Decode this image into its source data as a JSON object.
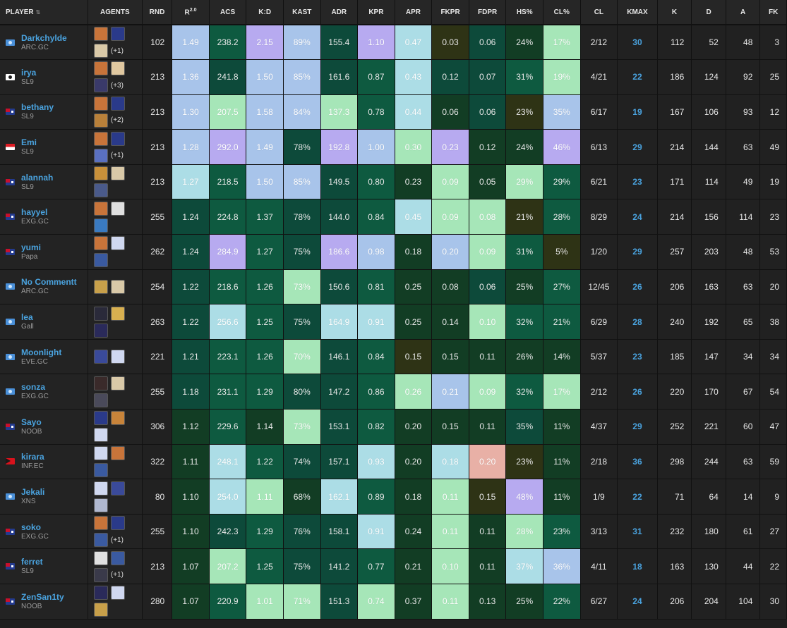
{
  "columns": [
    {
      "key": "player",
      "label": "PLAYER",
      "sort": true
    },
    {
      "key": "agents",
      "label": "AGENTS",
      "sort": false
    },
    {
      "key": "rnd",
      "label": "RND",
      "sort": true
    },
    {
      "key": "r2",
      "label": "R",
      "sup": "2.0",
      "sort": true
    },
    {
      "key": "acs",
      "label": "ACS",
      "sort": true
    },
    {
      "key": "kd",
      "label": "K:D",
      "sort": true
    },
    {
      "key": "kast",
      "label": "KAST",
      "sort": true
    },
    {
      "key": "adr",
      "label": "ADR",
      "sort": true
    },
    {
      "key": "kpr",
      "label": "KPR",
      "sort": true
    },
    {
      "key": "apr",
      "label": "APR",
      "sort": true
    },
    {
      "key": "fkpr",
      "label": "FKPR",
      "sort": true
    },
    {
      "key": "fdpr",
      "label": "FDPR",
      "sort": true
    },
    {
      "key": "hs",
      "label": "HS%",
      "sort": true
    },
    {
      "key": "clp",
      "label": "CL%",
      "sort": true
    },
    {
      "key": "cl",
      "label": "CL",
      "sort": true
    },
    {
      "key": "kmax",
      "label": "KMAX",
      "sort": true
    },
    {
      "key": "k",
      "label": "K",
      "sort": true
    },
    {
      "key": "d",
      "label": "D",
      "sort": true
    },
    {
      "key": "a",
      "label": "A",
      "sort": true
    },
    {
      "key": "fk",
      "label": "FK",
      "sort": true
    }
  ],
  "palette": {
    "p": "#b7aaf0",
    "b": "#a8c4ea",
    "c": "#acdde6",
    "g": "#a6e6b8",
    "d": "#0d4a3a",
    "e": "#0e5a40",
    "f": "#123d24",
    "o": "#2e3315",
    "r": "#e8b0a6"
  },
  "rows": [
    {
      "name": "Darkchylde",
      "team": "ARC.GC",
      "flag": "un",
      "agents": [
        "#c8743a",
        "#2a3a8a",
        "#d9c9a8"
      ],
      "more": "(+1)",
      "rnd": "102",
      "cells": [
        [
          "1.49",
          "b"
        ],
        [
          "238.2",
          "e"
        ],
        [
          "2.15",
          "p"
        ],
        [
          "89%",
          "b"
        ],
        [
          "155.4",
          "d"
        ],
        [
          "1.10",
          "p"
        ],
        [
          "0.47",
          "c"
        ],
        [
          "0.03",
          "o"
        ],
        [
          "0.06",
          "d"
        ],
        [
          "24%",
          "f"
        ],
        [
          "17%",
          "g"
        ]
      ],
      "cl": "2/12",
      "kmax": "30",
      "k": "112",
      "d": "52",
      "a": "48",
      "fk": "3"
    },
    {
      "name": "irya",
      "team": "SL9",
      "flag": "kr",
      "agents": [
        "#c8743a",
        "#e0c8a0",
        "#3a3a6a"
      ],
      "more": "(+3)",
      "rnd": "213",
      "cells": [
        [
          "1.36",
          "b"
        ],
        [
          "241.8",
          "d"
        ],
        [
          "1.50",
          "b"
        ],
        [
          "85%",
          "b"
        ],
        [
          "161.6",
          "d"
        ],
        [
          "0.87",
          "e"
        ],
        [
          "0.43",
          "c"
        ],
        [
          "0.12",
          "d"
        ],
        [
          "0.07",
          "d"
        ],
        [
          "31%",
          "e"
        ],
        [
          "19%",
          "g"
        ]
      ],
      "cl": "4/21",
      "kmax": "22",
      "k": "186",
      "d": "124",
      "a": "92",
      "fk": "25"
    },
    {
      "name": "bethany",
      "team": "SL9",
      "flag": "au",
      "agents": [
        "#c8743a",
        "#2a3a8a",
        "#b8803a"
      ],
      "more": "(+2)",
      "rnd": "213",
      "cells": [
        [
          "1.30",
          "b"
        ],
        [
          "207.5",
          "g"
        ],
        [
          "1.58",
          "b"
        ],
        [
          "84%",
          "b"
        ],
        [
          "137.3",
          "g"
        ],
        [
          "0.78",
          "e"
        ],
        [
          "0.44",
          "c"
        ],
        [
          "0.06",
          "f"
        ],
        [
          "0.06",
          "d"
        ],
        [
          "23%",
          "o"
        ],
        [
          "35%",
          "b"
        ]
      ],
      "cl": "6/17",
      "kmax": "19",
      "k": "167",
      "d": "106",
      "a": "93",
      "fk": "12"
    },
    {
      "name": "Emi",
      "team": "SL9",
      "flag": "id",
      "agents": [
        "#c8743a",
        "#2a3a8a",
        "#5a70c0"
      ],
      "more": "(+1)",
      "rnd": "213",
      "cells": [
        [
          "1.28",
          "b"
        ],
        [
          "292.0",
          "p"
        ],
        [
          "1.49",
          "b"
        ],
        [
          "78%",
          "d"
        ],
        [
          "192.8",
          "p"
        ],
        [
          "1.00",
          "b"
        ],
        [
          "0.30",
          "g"
        ],
        [
          "0.23",
          "p"
        ],
        [
          "0.12",
          "f"
        ],
        [
          "24%",
          "f"
        ],
        [
          "46%",
          "p"
        ]
      ],
      "cl": "6/13",
      "kmax": "29",
      "k": "214",
      "d": "144",
      "a": "63",
      "fk": "49"
    },
    {
      "name": "alannah",
      "team": "SL9",
      "flag": "au",
      "agents": [
        "#c8903a",
        "#d9c9a8",
        "#4a5a8a"
      ],
      "more": "",
      "rnd": "213",
      "cells": [
        [
          "1.27",
          "c"
        ],
        [
          "218.5",
          "e"
        ],
        [
          "1.50",
          "b"
        ],
        [
          "85%",
          "b"
        ],
        [
          "149.5",
          "d"
        ],
        [
          "0.80",
          "e"
        ],
        [
          "0.23",
          "f"
        ],
        [
          "0.09",
          "g"
        ],
        [
          "0.05",
          "f"
        ],
        [
          "29%",
          "g"
        ],
        [
          "29%",
          "e"
        ]
      ],
      "cl": "6/21",
      "kmax": "23",
      "k": "171",
      "d": "114",
      "a": "49",
      "fk": "19"
    },
    {
      "name": "hayyel",
      "team": "EXG.GC",
      "flag": "au",
      "agents": [
        "#c8743a",
        "#e0e0e0",
        "#3a7ac0"
      ],
      "more": "",
      "rnd": "255",
      "cells": [
        [
          "1.24",
          "d"
        ],
        [
          "224.8",
          "e"
        ],
        [
          "1.37",
          "e"
        ],
        [
          "78%",
          "d"
        ],
        [
          "144.0",
          "d"
        ],
        [
          "0.84",
          "e"
        ],
        [
          "0.45",
          "c"
        ],
        [
          "0.09",
          "g"
        ],
        [
          "0.08",
          "g"
        ],
        [
          "21%",
          "o"
        ],
        [
          "28%",
          "e"
        ]
      ],
      "cl": "8/29",
      "kmax": "24",
      "k": "214",
      "d": "156",
      "a": "114",
      "fk": "23"
    },
    {
      "name": "yumi",
      "team": "Papa",
      "flag": "au",
      "agents": [
        "#c8743a",
        "#d0d8f0",
        "#3a5aa0"
      ],
      "more": "",
      "rnd": "262",
      "cells": [
        [
          "1.24",
          "d"
        ],
        [
          "284.9",
          "p"
        ],
        [
          "1.27",
          "e"
        ],
        [
          "75%",
          "d"
        ],
        [
          "186.6",
          "p"
        ],
        [
          "0.98",
          "b"
        ],
        [
          "0.18",
          "f"
        ],
        [
          "0.20",
          "b"
        ],
        [
          "0.09",
          "g"
        ],
        [
          "31%",
          "e"
        ],
        [
          "5%",
          "o"
        ]
      ],
      "cl": "1/20",
      "kmax": "29",
      "k": "257",
      "d": "203",
      "a": "48",
      "fk": "53"
    },
    {
      "name": "No Commentt",
      "team": "ARC.GC",
      "flag": "un",
      "agents": [
        "#c8a04a",
        "#d9c9a8"
      ],
      "more": "",
      "rnd": "254",
      "cells": [
        [
          "1.22",
          "d"
        ],
        [
          "218.6",
          "e"
        ],
        [
          "1.26",
          "e"
        ],
        [
          "73%",
          "g"
        ],
        [
          "150.6",
          "d"
        ],
        [
          "0.81",
          "e"
        ],
        [
          "0.25",
          "f"
        ],
        [
          "0.08",
          "f"
        ],
        [
          "0.06",
          "d"
        ],
        [
          "25%",
          "f"
        ],
        [
          "27%",
          "e"
        ]
      ],
      "cl": "12/45",
      "kmax": "26",
      "k": "206",
      "d": "163",
      "a": "63",
      "fk": "20"
    },
    {
      "name": "lea",
      "team": "Gall",
      "flag": "un",
      "agents": [
        "#2a2a3a",
        "#d8b050",
        "#2a2a5a"
      ],
      "more": "",
      "rnd": "263",
      "cells": [
        [
          "1.22",
          "d"
        ],
        [
          "256.6",
          "c"
        ],
        [
          "1.25",
          "e"
        ],
        [
          "75%",
          "d"
        ],
        [
          "164.9",
          "c"
        ],
        [
          "0.91",
          "c"
        ],
        [
          "0.25",
          "f"
        ],
        [
          "0.14",
          "f"
        ],
        [
          "0.10",
          "g"
        ],
        [
          "32%",
          "e"
        ],
        [
          "21%",
          "e"
        ]
      ],
      "cl": "6/29",
      "kmax": "28",
      "k": "240",
      "d": "192",
      "a": "65",
      "fk": "38"
    },
    {
      "name": "Moonlight",
      "team": "EVE.GC",
      "flag": "un",
      "agents": [
        "#3a4a9a",
        "#d0d8f0"
      ],
      "more": "",
      "rnd": "221",
      "cells": [
        [
          "1.21",
          "d"
        ],
        [
          "223.1",
          "e"
        ],
        [
          "1.26",
          "e"
        ],
        [
          "70%",
          "g"
        ],
        [
          "146.1",
          "d"
        ],
        [
          "0.84",
          "e"
        ],
        [
          "0.15",
          "o"
        ],
        [
          "0.15",
          "f"
        ],
        [
          "0.11",
          "f"
        ],
        [
          "26%",
          "f"
        ],
        [
          "14%",
          "f"
        ]
      ],
      "cl": "5/37",
      "kmax": "23",
      "k": "185",
      "d": "147",
      "a": "34",
      "fk": "34"
    },
    {
      "name": "sonza",
      "team": "EXG.GC",
      "flag": "un",
      "agents": [
        "#3a2a2a",
        "#d9c9a8",
        "#4a4a5a"
      ],
      "more": "",
      "rnd": "255",
      "cells": [
        [
          "1.18",
          "d"
        ],
        [
          "231.1",
          "e"
        ],
        [
          "1.29",
          "e"
        ],
        [
          "80%",
          "d"
        ],
        [
          "147.2",
          "d"
        ],
        [
          "0.86",
          "e"
        ],
        [
          "0.26",
          "g"
        ],
        [
          "0.21",
          "b"
        ],
        [
          "0.09",
          "g"
        ],
        [
          "32%",
          "e"
        ],
        [
          "17%",
          "g"
        ]
      ],
      "cl": "2/12",
      "kmax": "26",
      "k": "220",
      "d": "170",
      "a": "67",
      "fk": "54"
    },
    {
      "name": "Sayo",
      "team": "NOOB",
      "flag": "au",
      "agents": [
        "#2a3a8a",
        "#c8843a",
        "#d0d8f0"
      ],
      "more": "",
      "rnd": "306",
      "cells": [
        [
          "1.12",
          "f"
        ],
        [
          "229.6",
          "e"
        ],
        [
          "1.14",
          "f"
        ],
        [
          "73%",
          "g"
        ],
        [
          "153.1",
          "d"
        ],
        [
          "0.82",
          "e"
        ],
        [
          "0.20",
          "f"
        ],
        [
          "0.15",
          "f"
        ],
        [
          "0.11",
          "f"
        ],
        [
          "35%",
          "d"
        ],
        [
          "11%",
          "f"
        ]
      ],
      "cl": "4/37",
      "kmax": "29",
      "k": "252",
      "d": "221",
      "a": "60",
      "fk": "47"
    },
    {
      "name": "kirara",
      "team": "INF.EC",
      "flag": "tl",
      "agents": [
        "#d0d8f0",
        "#c8743a",
        "#3a5aa0"
      ],
      "more": "",
      "rnd": "322",
      "cells": [
        [
          "1.11",
          "f"
        ],
        [
          "248.1",
          "c"
        ],
        [
          "1.22",
          "e"
        ],
        [
          "74%",
          "d"
        ],
        [
          "157.1",
          "d"
        ],
        [
          "0.93",
          "c"
        ],
        [
          "0.20",
          "f"
        ],
        [
          "0.18",
          "c"
        ],
        [
          "0.20",
          "r"
        ],
        [
          "23%",
          "o"
        ],
        [
          "11%",
          "f"
        ]
      ],
      "cl": "2/18",
      "kmax": "36",
      "k": "298",
      "d": "244",
      "a": "63",
      "fk": "59"
    },
    {
      "name": "Jekali",
      "team": "XNS",
      "flag": "un",
      "agents": [
        "#d0d8f0",
        "#3a4a9a",
        "#b0b8d0"
      ],
      "more": "",
      "rnd": "80",
      "cells": [
        [
          "1.10",
          "f"
        ],
        [
          "254.0",
          "c"
        ],
        [
          "1.11",
          "g"
        ],
        [
          "68%",
          "f"
        ],
        [
          "162.1",
          "c"
        ],
        [
          "0.89",
          "e"
        ],
        [
          "0.18",
          "f"
        ],
        [
          "0.11",
          "g"
        ],
        [
          "0.15",
          "o"
        ],
        [
          "48%",
          "p"
        ],
        [
          "11%",
          "f"
        ]
      ],
      "cl": "1/9",
      "kmax": "22",
      "k": "71",
      "d": "64",
      "a": "14",
      "fk": "9"
    },
    {
      "name": "soko",
      "team": "EXG.GC",
      "flag": "au",
      "agents": [
        "#c8743a",
        "#2a3a8a",
        "#3a5aa0"
      ],
      "more": "(+1)",
      "rnd": "255",
      "cells": [
        [
          "1.10",
          "f"
        ],
        [
          "242.3",
          "d"
        ],
        [
          "1.29",
          "e"
        ],
        [
          "76%",
          "d"
        ],
        [
          "158.1",
          "d"
        ],
        [
          "0.91",
          "c"
        ],
        [
          "0.24",
          "f"
        ],
        [
          "0.11",
          "g"
        ],
        [
          "0.11",
          "f"
        ],
        [
          "28%",
          "g"
        ],
        [
          "23%",
          "e"
        ]
      ],
      "cl": "3/13",
      "kmax": "31",
      "k": "232",
      "d": "180",
      "a": "61",
      "fk": "27"
    },
    {
      "name": "ferret",
      "team": "SL9",
      "flag": "au",
      "agents": [
        "#e0e0e0",
        "#3a5aa0",
        "#3a3a4a"
      ],
      "more": "(+1)",
      "rnd": "213",
      "cells": [
        [
          "1.07",
          "f"
        ],
        [
          "207.2",
          "g"
        ],
        [
          "1.25",
          "e"
        ],
        [
          "75%",
          "d"
        ],
        [
          "141.2",
          "d"
        ],
        [
          "0.77",
          "e"
        ],
        [
          "0.21",
          "f"
        ],
        [
          "0.10",
          "g"
        ],
        [
          "0.11",
          "f"
        ],
        [
          "37%",
          "c"
        ],
        [
          "36%",
          "b"
        ]
      ],
      "cl": "4/11",
      "kmax": "18",
      "k": "163",
      "d": "130",
      "a": "44",
      "fk": "22"
    },
    {
      "name": "ZenSan1ty",
      "team": "NOOB",
      "flag": "au",
      "agents": [
        "#2a2a5a",
        "#d0d8f0",
        "#c8a04a"
      ],
      "more": "",
      "rnd": "280",
      "cells": [
        [
          "1.07",
          "f"
        ],
        [
          "220.9",
          "e"
        ],
        [
          "1.01",
          "g"
        ],
        [
          "71%",
          "g"
        ],
        [
          "151.3",
          "d"
        ],
        [
          "0.74",
          "g"
        ],
        [
          "0.37",
          "f"
        ],
        [
          "0.11",
          "g"
        ],
        [
          "0.13",
          "f"
        ],
        [
          "25%",
          "f"
        ],
        [
          "22%",
          "e"
        ]
      ],
      "cl": "6/27",
      "kmax": "24",
      "k": "206",
      "d": "204",
      "a": "104",
      "fk": "30"
    }
  ]
}
